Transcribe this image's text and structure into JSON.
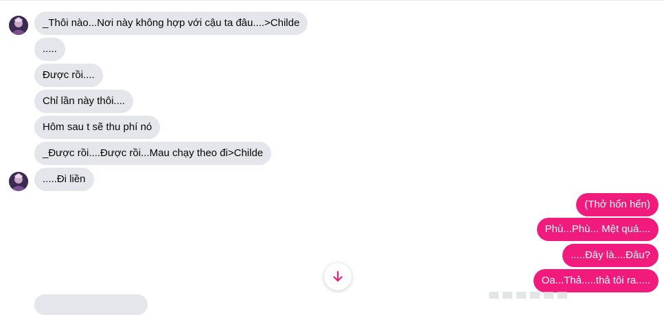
{
  "incoming": [
    {
      "text": "_Thôi nào...Nơi này không hợp với cậu ta đâu....>Childe"
    },
    {
      "text": "....."
    },
    {
      "text": "Được rồi...."
    },
    {
      "text": "Chỉ lần này thôi...."
    },
    {
      "text": "Hôm sau t sẽ thu phí nó"
    },
    {
      "text": "_Được rồi....Được rồi...Mau chạy theo đi>Childe"
    },
    {
      "text": ".....Đi liền"
    }
  ],
  "outgoing": [
    {
      "text": "(Thở hổn hển)"
    },
    {
      "text": "Phù...Phù... Mệt quá...."
    },
    {
      "text": ".....Đây là....Đâu?"
    },
    {
      "text": "Oa...Thả.....thả tôi ra....."
    }
  ],
  "colors": {
    "incoming_bubble": "#e4e6eb",
    "outgoing_bubble": "#f01b7c",
    "scroll_arrow": "#f01b7c"
  },
  "icons": {
    "scroll_down": "arrow-down-icon",
    "avatar": "contact-avatar"
  }
}
